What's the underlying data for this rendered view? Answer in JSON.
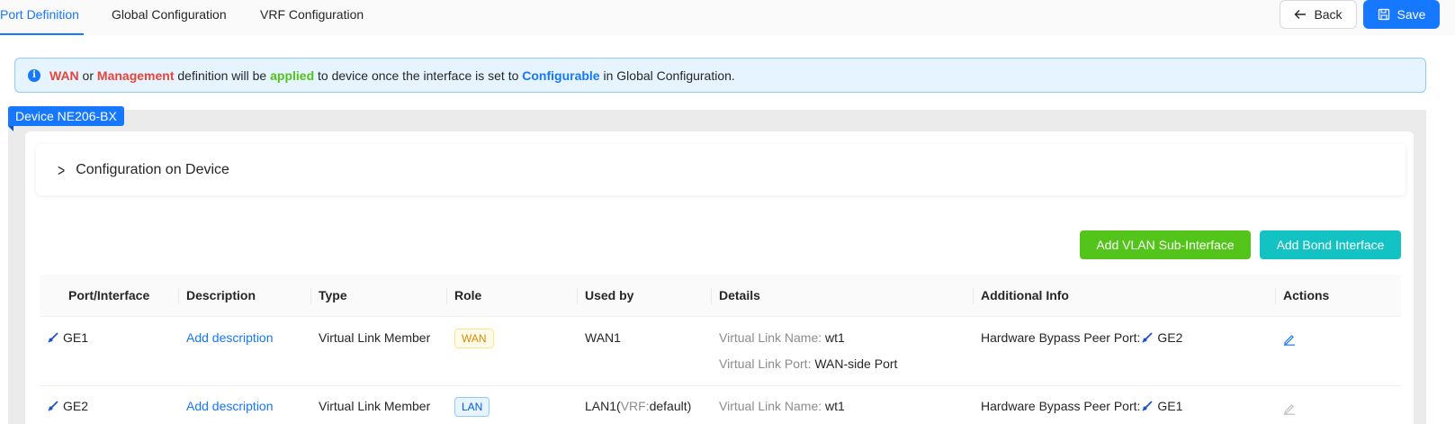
{
  "tabs": [
    {
      "label": "Port Definition",
      "active": true
    },
    {
      "label": "Global Configuration",
      "active": false
    },
    {
      "label": "VRF Configuration",
      "active": false
    }
  ],
  "header_buttons": {
    "back_label": "Back",
    "save_label": "Save"
  },
  "alert": {
    "wan": "WAN",
    "or": " or ",
    "management": "Management",
    "text1": " definition will be ",
    "applied": "applied",
    "text2": " to device once the interface is set to ",
    "configurable": "Configurable",
    "text3": " in Global Configuration."
  },
  "device": {
    "tag_label": "Device NE206-BX",
    "collapse_label": "Configuration on Device"
  },
  "actions": {
    "add_vlan_label": "Add VLAN Sub-Interface",
    "add_bond_label": "Add Bond Interface"
  },
  "table": {
    "columns": [
      "Port/Interface",
      "Description",
      "Type",
      "Role",
      "Used by",
      "Details",
      "Additional Info",
      "Actions"
    ],
    "rows": [
      {
        "port": "GE1",
        "description": "Add description",
        "type": "Virtual Link Member",
        "role": "WAN",
        "used_by": "WAN1",
        "used_by_vrf_label": "",
        "used_by_vrf_value": "",
        "details_name_label": "Virtual Link Name: ",
        "details_name_value": "wt1",
        "details_port_label": "Virtual Link Port: ",
        "details_port_value": "WAN-side Port",
        "additional_label": "Hardware Bypass Peer Port:",
        "additional_value": "GE2"
      },
      {
        "port": "GE2",
        "description": "Add description",
        "type": "Virtual Link Member",
        "role": "LAN",
        "used_by": "LAN1(",
        "used_by_vrf_label": "VRF:",
        "used_by_vrf_value": "default)",
        "details_name_label": "Virtual Link Name: ",
        "details_name_value": "wt1",
        "additional_label": "Hardware Bypass Peer Port:",
        "additional_value": "GE1"
      }
    ]
  },
  "colors": {
    "primary": "#1677ff",
    "success": "#52c41a",
    "cyan": "#13c2c2",
    "danger": "#e8443a"
  }
}
